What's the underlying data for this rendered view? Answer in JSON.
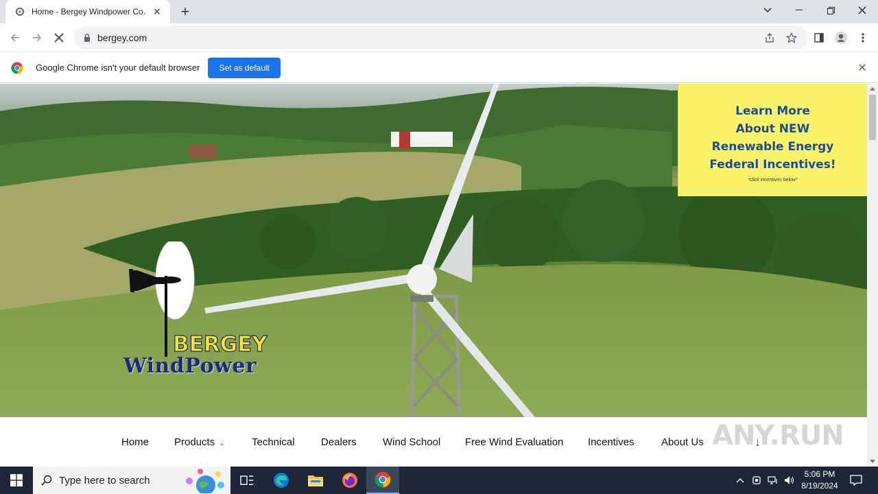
{
  "browser": {
    "tab_title": "Home - Bergey Windpower Co.",
    "url": "bergey.com",
    "infobar_message": "Google Chrome isn't your default browser",
    "set_default_label": "Set as default"
  },
  "promo": {
    "lines": [
      "Learn More",
      "About NEW",
      "Renewable Energy",
      "Federal Incentives!"
    ],
    "note": "*click incentives below*"
  },
  "logo": {
    "line1": "BERGEY",
    "line2": "WindPower"
  },
  "nav": {
    "items": [
      "Home",
      "Products",
      "Technical",
      "Dealers",
      "Wind School",
      "Free Wind Evaluation",
      "Incentives",
      "About Us"
    ]
  },
  "watermark": "ANY.RUN",
  "taskbar": {
    "search_placeholder": "Type here to search",
    "time": "5:06 PM",
    "date": "8/19/2024"
  }
}
